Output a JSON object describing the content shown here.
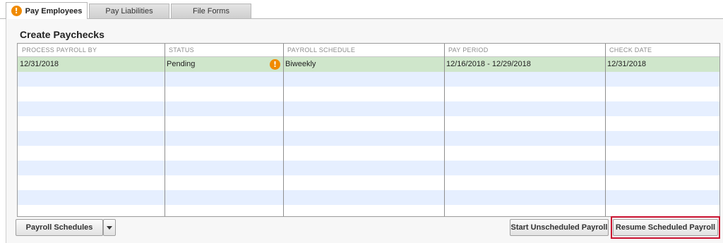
{
  "tabs": [
    {
      "label": "Pay Employees",
      "active": true,
      "icon": "alert-icon"
    },
    {
      "label": "Pay Liabilities",
      "active": false
    },
    {
      "label": "File Forms",
      "active": false
    }
  ],
  "section": {
    "title": "Create Paychecks"
  },
  "table": {
    "columns": [
      "PROCESS PAYROLL BY",
      "STATUS",
      "PAYROLL SCHEDULE",
      "PAY PERIOD",
      "CHECK DATE"
    ],
    "rows": [
      {
        "process_by": "12/31/2018",
        "status": "Pending",
        "status_icon": "warning-icon",
        "schedule": "Biweekly",
        "pay_period": "12/16/2018 - 12/29/2018",
        "check_date": "12/31/2018"
      }
    ]
  },
  "buttons": {
    "payroll_schedules": "Payroll Schedules",
    "start_unscheduled": "Start Unscheduled Payroll",
    "resume_scheduled": "Resume Scheduled Payroll"
  },
  "colors": {
    "selected_row": "#cfe6cb",
    "alt_row": "#e6efff",
    "alert": "#f08a00",
    "highlight_border": "#c8102e"
  }
}
